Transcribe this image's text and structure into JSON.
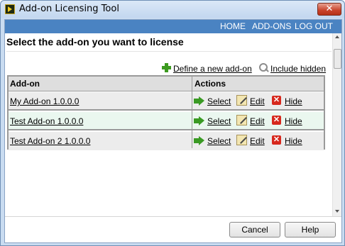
{
  "window": {
    "title": "Add-on Licensing Tool",
    "close_label": "✕"
  },
  "nav": {
    "items": [
      "HOME",
      "ADD-ONS",
      "LOG OUT"
    ]
  },
  "page": {
    "title": "Select the add-on you want to license"
  },
  "links": {
    "define_new": "Define a new add-on",
    "include_hidden": "Include hidden"
  },
  "table": {
    "headers": [
      "Add-on",
      "Actions"
    ],
    "rows": [
      {
        "name": "My Add-on  1.0.0.0",
        "select": "Select",
        "edit": "Edit",
        "hide": "Hide"
      },
      {
        "name": "Test Add-on  1.0.0.0",
        "select": "Select",
        "edit": "Edit",
        "hide": "Hide"
      },
      {
        "name": "Test Add-on 2  1.0.0.0",
        "select": "Select",
        "edit": "Edit",
        "hide": "Hide"
      }
    ]
  },
  "buttons": {
    "cancel": "Cancel",
    "help": "Help"
  },
  "colors": {
    "nav_bar": "#4a83c2",
    "row_odd": "#ececec",
    "row_even": "#eaf7ef",
    "close_red": "#c8432b"
  }
}
